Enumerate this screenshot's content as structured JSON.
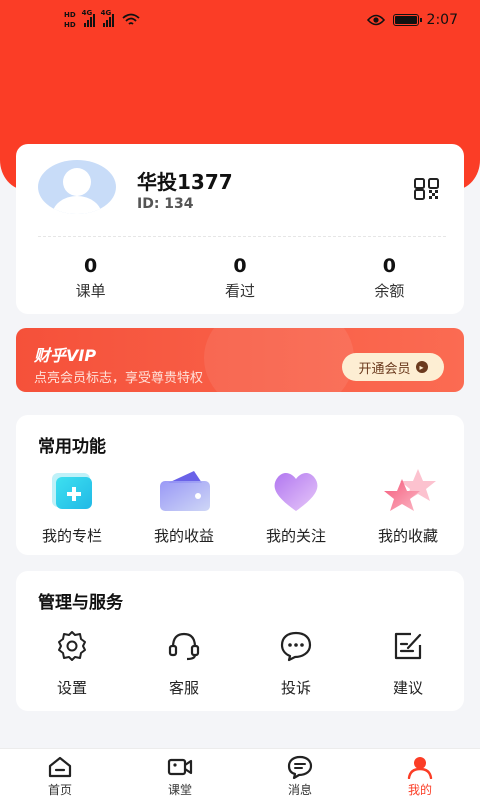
{
  "status_bar": {
    "hd_top": "HD",
    "hd_bottom": "HD",
    "net1": "4G",
    "net2": "4G",
    "time": "2:07"
  },
  "profile": {
    "name": "华投1377",
    "id_text": "ID: 134",
    "stats": [
      {
        "value": "0",
        "label": "课单"
      },
      {
        "value": "0",
        "label": "看过"
      },
      {
        "value": "0",
        "label": "余额"
      }
    ]
  },
  "vip": {
    "title": "财乎VIP",
    "subtitle": "点亮会员标志，享受尊贵特权",
    "button": "开通会员"
  },
  "common_functions": {
    "title": "常用功能",
    "items": [
      {
        "label": "我的专栏",
        "icon": "column-icon"
      },
      {
        "label": "我的收益",
        "icon": "wallet-icon"
      },
      {
        "label": "我的关注",
        "icon": "heart-icon"
      },
      {
        "label": "我的收藏",
        "icon": "star-icon"
      }
    ]
  },
  "management": {
    "title": "管理与服务",
    "items": [
      {
        "label": "设置",
        "icon": "gear-icon"
      },
      {
        "label": "客服",
        "icon": "headset-icon"
      },
      {
        "label": "投诉",
        "icon": "chat-bubble-icon"
      },
      {
        "label": "建议",
        "icon": "edit-note-icon"
      }
    ]
  },
  "tabbar": {
    "tabs": [
      {
        "label": "首页",
        "icon": "home-icon"
      },
      {
        "label": "课堂",
        "icon": "video-camera-icon"
      },
      {
        "label": "消息",
        "icon": "message-icon"
      },
      {
        "label": "我的",
        "icon": "user-icon",
        "active": true
      }
    ]
  },
  "colors": {
    "brand_red": "#fb3d26",
    "vip_button_bg": "#fdeed3",
    "active_tab": "#fb3d26"
  }
}
